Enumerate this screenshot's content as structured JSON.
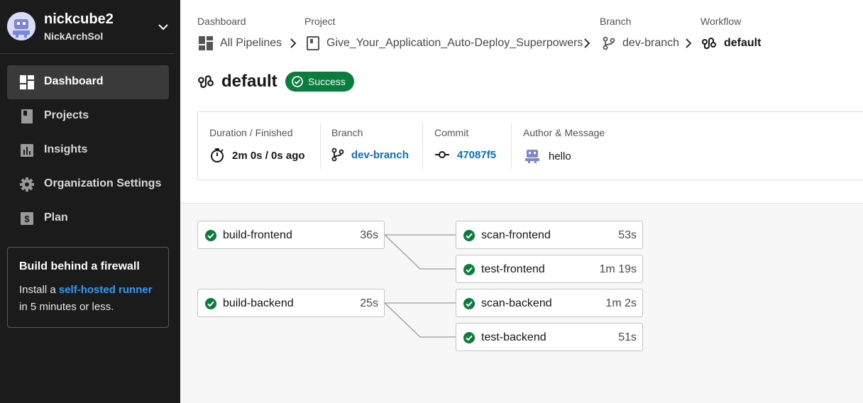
{
  "org": {
    "name": "nickcube2",
    "user": "NickArchSol"
  },
  "nav": {
    "dashboard": "Dashboard",
    "projects": "Projects",
    "insights": "Insights",
    "org_settings": "Organization Settings",
    "plan": "Plan"
  },
  "promo": {
    "title": "Build behind a firewall",
    "prefix": "Install a ",
    "link": "self-hosted runner",
    "suffix": "in 5 minutes or less."
  },
  "breadcrumbs": {
    "dashboard_label": "Dashboard",
    "dashboard_value": "All Pipelines",
    "project_label": "Project",
    "project_value": "Give_Your_Application_Auto-Deploy_Superpowers",
    "branch_label": "Branch",
    "branch_value": "dev-branch",
    "workflow_label": "Workflow",
    "workflow_value": "default"
  },
  "workflow": {
    "name": "default",
    "status": "Success"
  },
  "details": {
    "duration_label": "Duration / Finished",
    "duration_value": "2m 0s / 0s ago",
    "branch_label": "Branch",
    "branch_value": "dev-branch",
    "commit_label": "Commit",
    "commit_value": "47087f5",
    "author_label": "Author & Message",
    "message": "hello"
  },
  "jobs": {
    "build_frontend": {
      "name": "build-frontend",
      "duration": "36s"
    },
    "scan_frontend": {
      "name": "scan-frontend",
      "duration": "53s"
    },
    "test_frontend": {
      "name": "test-frontend",
      "duration": "1m 19s"
    },
    "build_backend": {
      "name": "build-backend",
      "duration": "25s"
    },
    "scan_backend": {
      "name": "scan-backend",
      "duration": "1m 2s"
    },
    "test_backend": {
      "name": "test-backend",
      "duration": "51s"
    }
  },
  "colors": {
    "sidebar": "#1b1b1b",
    "success": "#0a7d3c",
    "link": "#0f6fc6",
    "avatar": "#7b86d6"
  }
}
